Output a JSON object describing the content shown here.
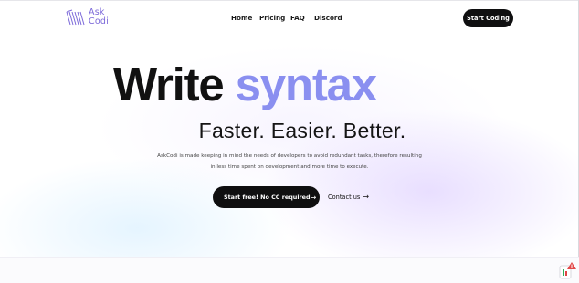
{
  "brand": {
    "logo_line1": "Ask",
    "logo_line2": "Codi",
    "logo_icon": "askcodi-logo-icon",
    "accent_color": "#8a8ff0",
    "logo_color": "#7c69d9"
  },
  "nav": {
    "items": [
      {
        "label": "Home"
      },
      {
        "label": "Pricing"
      },
      {
        "label": "FAQ"
      },
      {
        "label": "Discord"
      }
    ],
    "cta_label": "Start Coding"
  },
  "hero": {
    "title_part1": "Write",
    "title_part2": "syntax",
    "subtitle": "Faster. Easier. Better.",
    "description_line1": "AskCodi is made keeping in mind the needs of developers to avoid redundant tasks, therefore resulting",
    "description_line2": "in less time spent on development and more time to execute.",
    "primary_cta": "Start free! No CC required",
    "primary_cta_icon": "arrow-right-icon",
    "secondary_cta": "Contact us",
    "secondary_cta_icon": "arrow-right-icon"
  },
  "widget": {
    "icon": "notification-badge-icon"
  }
}
